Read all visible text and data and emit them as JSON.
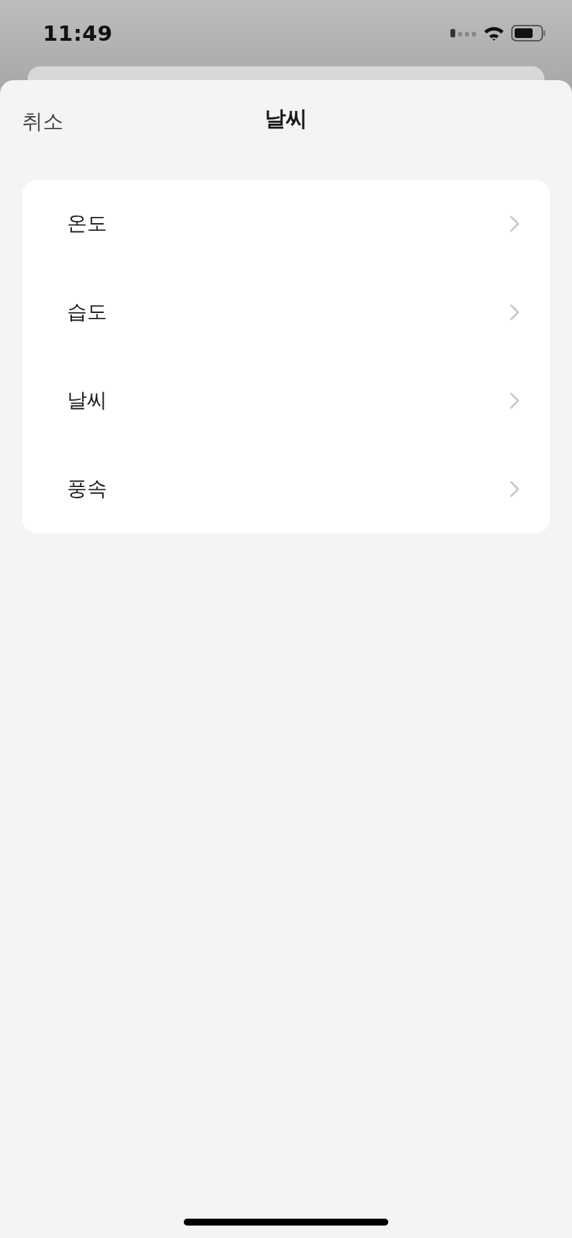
{
  "status_bar": {
    "time": "11:49"
  },
  "sheet": {
    "cancel": "취소",
    "title": "날씨"
  },
  "items": [
    {
      "label": "온도"
    },
    {
      "label": "습도"
    },
    {
      "label": "날씨"
    },
    {
      "label": "풍속"
    }
  ]
}
